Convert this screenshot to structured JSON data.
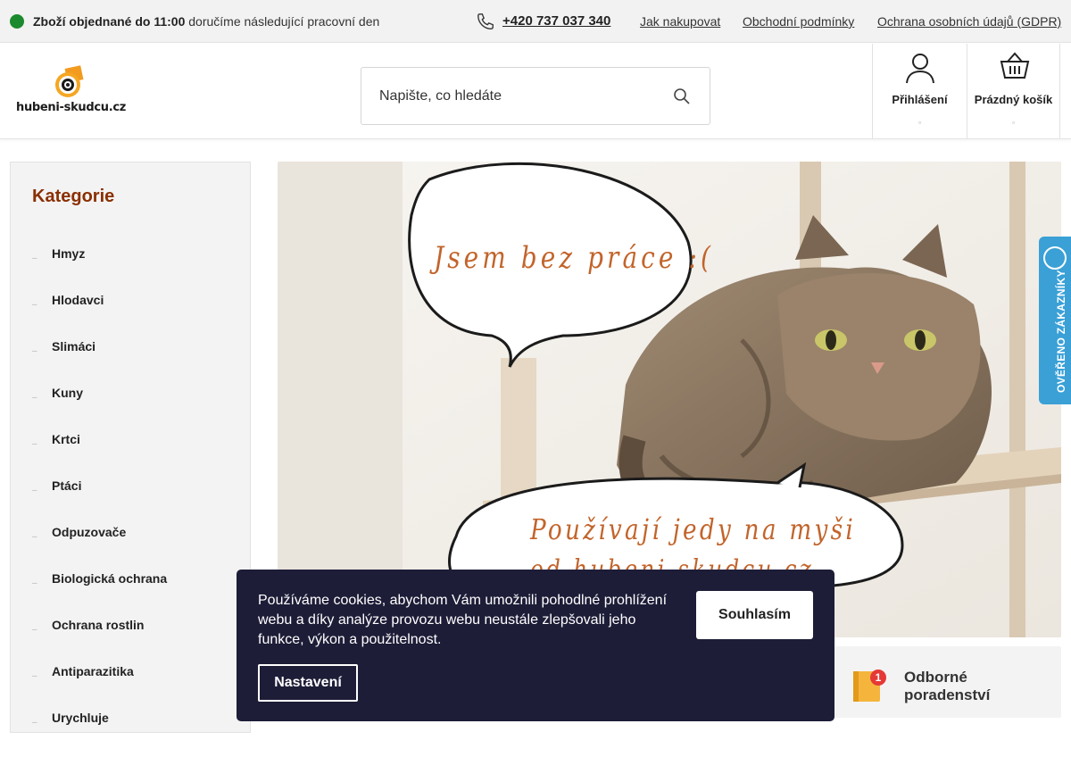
{
  "topbar": {
    "delivery_bold": "Zboží objednané do 11:00",
    "delivery_rest": " doručíme následující pracovní den",
    "phone": "+420 737 037 340",
    "links": [
      "Jak nakupovat",
      "Obchodní podmínky",
      "Ochrana osobních údajů (GDPR)"
    ],
    "status_color": "#1b8a2f"
  },
  "header": {
    "logo_text": "hubeni-skudcu.cz",
    "search_placeholder": "Napište, co hledáte",
    "login_label": "Přihlášení",
    "cart_label": "Prázdný košík",
    "caret": "▫"
  },
  "sidebar": {
    "title": "Kategorie",
    "bullet": "–",
    "items": [
      "Hmyz",
      "Hlodavci",
      "Slimáci",
      "Kuny",
      "Krtci",
      "Ptáci",
      "Odpuzovače",
      "Biologická ochrana",
      "Ochrana rostlin",
      "Antiparazitika",
      "Urychluje"
    ]
  },
  "banner": {
    "bubble_top": "Jsem bez práce :(",
    "bubble_bottom_1": "Používají jedy na myši",
    "bubble_bottom_2": "od hubeni-skudcu.cz",
    "text_color": "#c2642b"
  },
  "badge": {
    "label": "OVĚŘENO ZÁKAZNÍKY",
    "color": "#3aa0d6"
  },
  "advice": {
    "label": "Odborné poradenství",
    "badge_number": "1"
  },
  "cookie": {
    "text": "Používáme cookies, abychom Vám umožnili pohodlné prohlížení webu a díky analýze provozu webu neustále zlepšovali jeho funkce, výkon a použitelnost.",
    "agree_label": "Souhlasím",
    "settings_label": "Nastavení",
    "bg_color": "#1d1d38"
  }
}
